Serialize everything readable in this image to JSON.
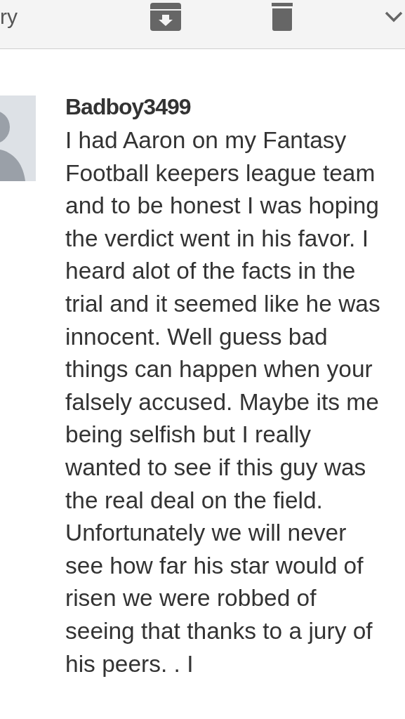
{
  "toolbar": {
    "back_label": "ry"
  },
  "comment": {
    "author": "Badboy3499",
    "text": "I had Aaron on my Fantasy Football keepers league team and to be honest I was hoping the verdict went in his favor. I heard alot of the facts in the trial and it seemed like he was innocent. Well guess bad things can happen when your falsely accused. Maybe its me being selfish but I really wanted to see if this guy was the real deal on the field. Unfortunately we will never see how far his star would of risen we were robbed of seeing that thanks to a jury of his peers. . I"
  }
}
